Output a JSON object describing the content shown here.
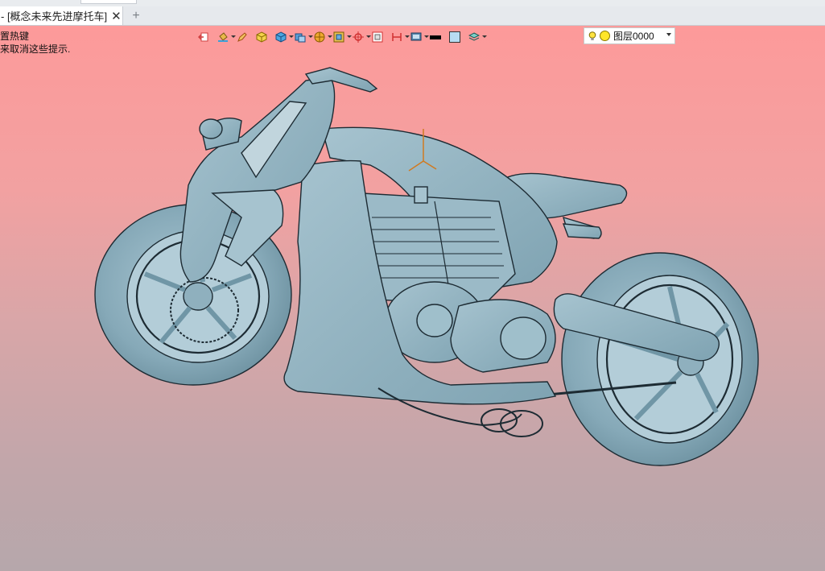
{
  "tab": {
    "title": "- [概念未来先进摩托车]",
    "close_glyph": "✕",
    "new_glyph": "+"
  },
  "hints": {
    "line1": "置热键",
    "line2": "来取消这些提示."
  },
  "toolbar": {
    "icons": [
      "exit-sketch-icon",
      "paint-bucket-icon",
      "pencil-icon",
      "yellow-cube-icon",
      "blue-cube-icon",
      "solid-view-icon",
      "sphere-shading-icon",
      "frame-view-icon",
      "axis-orient-icon",
      "square-select-icon",
      "dimension-icon",
      "display-mode-icon",
      "black-color-swatch",
      "light-blue-color-swatch",
      "layer-stack-icon"
    ],
    "layer_combo": {
      "value": "图层0000"
    }
  },
  "colors": {
    "viewport_top": "#fd9a9a",
    "viewport_bottom": "#b6a7ab",
    "model_fill": "#8fb3c1",
    "model_edge": "#1d2b33"
  }
}
